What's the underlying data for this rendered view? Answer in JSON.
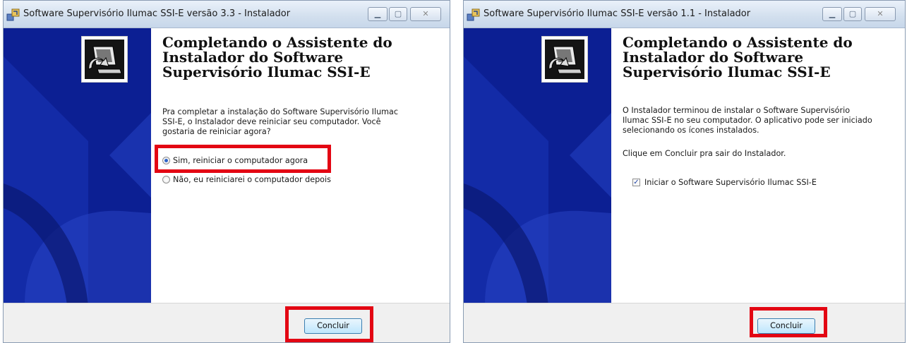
{
  "window1": {
    "title": "Software Supervisório Ilumac SSI-E versão 3.3 - Instalador",
    "heading_lines": [
      "Completando o Assistente do",
      "Instalador do Software",
      "Supervisório Ilumac SSI-E"
    ],
    "paragraph_lines": [
      "Pra completar a instalação do Software Supervisório Ilumac",
      "SSI-E, o Instalador deve reiniciar seu computador. Você",
      "gostaria de reiniciar agora?"
    ],
    "radio_restart_now": "Sim, reiniciar o computador agora",
    "radio_restart_later": "Não, eu reiniciarei o computador depois",
    "radio_selected": "restart_now",
    "finish_button": "Concluir"
  },
  "window2": {
    "title": "Software Supervisório Ilumac SSI-E versão 1.1 - Instalador",
    "heading_lines": [
      "Completando o Assistente do",
      "Instalador do Software",
      "Supervisório Ilumac SSI-E"
    ],
    "paragraph_lines": [
      "O Instalador terminou de instalar o Software Supervisório",
      "Ilumac SSI-E no seu computador. O aplicativo pode ser iniciado",
      "selecionando os ícones instalados."
    ],
    "paragraph2": "Clique em Concluir pra sair do Instalador.",
    "checkbox_label": "Iniciar o  Software Supervisório Ilumac SSI-E",
    "checkbox_checked": true,
    "finish_button": "Concluir"
  },
  "icons": {
    "window_controls": [
      "minimize-icon",
      "maximize-icon",
      "close-icon"
    ],
    "app": "installer-app-icon",
    "wizard": "installer-computer-icon"
  },
  "colors": {
    "sidebar_blue": "#0c1f93",
    "highlight_red": "#e30613"
  }
}
